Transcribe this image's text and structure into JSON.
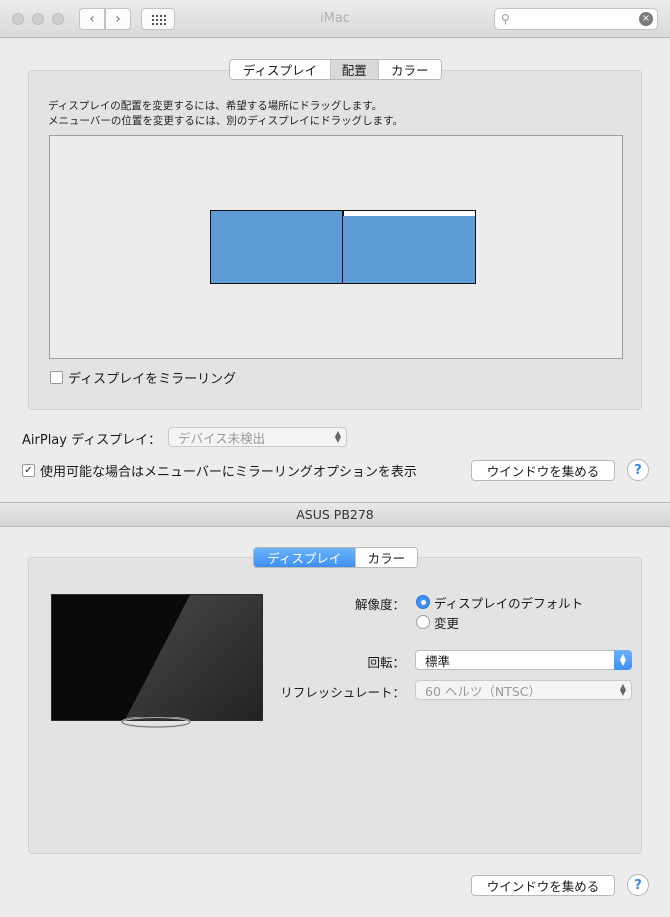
{
  "window1": {
    "title": "iMac",
    "search": {
      "placeholder": ""
    },
    "tabs": [
      {
        "label": "ディスプレイ",
        "selected": false
      },
      {
        "label": "配置",
        "selected": true
      },
      {
        "label": "カラー",
        "selected": false
      }
    ],
    "instructions": [
      "ディスプレイの配置を変更するには、希望する場所にドラッグします。",
      "メニューバーの位置を変更するには、別のディスプレイにドラッグします。"
    ],
    "mirror_label": "ディスプレイをミラーリング",
    "mirror_checked": false,
    "airplay_label": "AirPlay ディスプレイ：",
    "airplay_value": "デバイス未検出",
    "menubar_option_label": "使用可能な場合はメニューバーにミラーリングオプションを表示",
    "menubar_option_checked": true,
    "gather_button": "ウインドウを集める",
    "help": "?"
  },
  "window2": {
    "title": "ASUS PB278",
    "tabs": [
      {
        "label": "ディスプレイ",
        "selected": true
      },
      {
        "label": "カラー",
        "selected": false
      }
    ],
    "resolution_label": "解像度：",
    "resolution_options": [
      "ディスプレイのデフォルト",
      "変更"
    ],
    "resolution_selected": "ディスプレイのデフォルト",
    "rotation_label": "回転：",
    "rotation_value": "標準",
    "refresh_label": "リフレッシュレート：",
    "refresh_value": "60 ヘルツ（NTSC）",
    "gather_button": "ウインドウを集める",
    "help": "?"
  },
  "colors": {
    "accent": "#3d8ff5",
    "display_blue": "#5f9bd5"
  }
}
